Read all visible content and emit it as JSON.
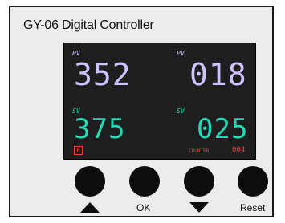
{
  "device": {
    "title": "GY-06 Digital Controller"
  },
  "display": {
    "left": {
      "pv_tag": "PV",
      "pv_value": "352",
      "sv_tag": "SV",
      "sv_value": "375",
      "unit": "F"
    },
    "right": {
      "pv_tag": "PV",
      "pv_value": "018",
      "sv_tag": "SV",
      "sv_value": "025",
      "counter_label": "COUNTER",
      "counter_value": "004"
    },
    "colors": {
      "screen_bg": "#1e1e1e",
      "pv": "#cfc2ff",
      "sv": "#27d7b6",
      "indicator": "#ff3b3b"
    }
  },
  "buttons": [
    {
      "name": "up",
      "icon": "arrow-up-icon"
    },
    {
      "name": "ok",
      "label": "OK"
    },
    {
      "name": "down",
      "icon": "arrow-down-icon"
    },
    {
      "name": "reset",
      "label": "Reset"
    }
  ]
}
